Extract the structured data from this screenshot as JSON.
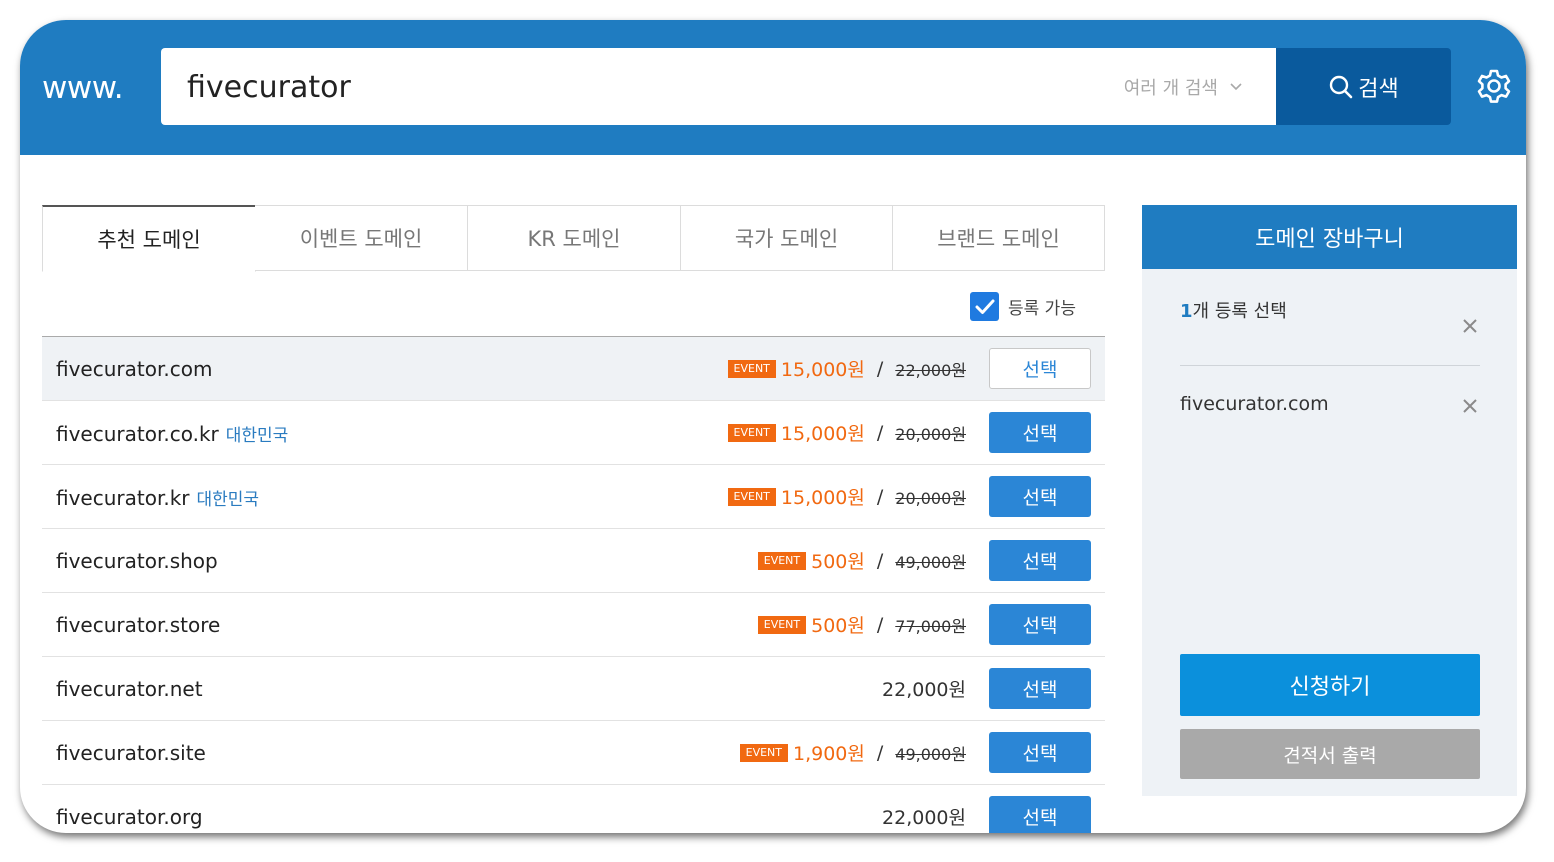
{
  "header": {
    "prefix": "www.",
    "search_value": "fivecurator",
    "multi_search_label": "여러 개 검색",
    "search_button_label": "검색",
    "colors": {
      "bar": "#1f7cc1",
      "search_button": "#0a5a9d"
    }
  },
  "tabs": [
    {
      "label": "추천 도메인",
      "active": true
    },
    {
      "label": "이벤트 도메인",
      "active": false
    },
    {
      "label": "KR 도메인",
      "active": false
    },
    {
      "label": "국가 도메인",
      "active": false
    },
    {
      "label": "브랜드 도메인",
      "active": false
    }
  ],
  "filter": {
    "available_label": "등록 가능",
    "checked": true
  },
  "domains": [
    {
      "name": "fivecurator.com",
      "country": "",
      "event": "EVENT",
      "price": "15,000원",
      "slash": "/",
      "original": "22,000원",
      "button": "선택",
      "selected": true
    },
    {
      "name": "fivecurator.co.kr",
      "country": "대한민국",
      "event": "EVENT",
      "price": "15,000원",
      "slash": "/",
      "original": "20,000원",
      "button": "선택",
      "selected": false
    },
    {
      "name": "fivecurator.kr",
      "country": "대한민국",
      "event": "EVENT",
      "price": "15,000원",
      "slash": "/",
      "original": "20,000원",
      "button": "선택",
      "selected": false
    },
    {
      "name": "fivecurator.shop",
      "country": "",
      "event": "EVENT",
      "price": "500원",
      "slash": "/",
      "original": "49,000원",
      "button": "선택",
      "selected": false
    },
    {
      "name": "fivecurator.store",
      "country": "",
      "event": "EVENT",
      "price": "500원",
      "slash": "/",
      "original": "77,000원",
      "button": "선택",
      "selected": false
    },
    {
      "name": "fivecurator.net",
      "country": "",
      "event": "",
      "price": "22,000원",
      "slash": "",
      "original": "",
      "button": "선택",
      "selected": false
    },
    {
      "name": "fivecurator.site",
      "country": "",
      "event": "EVENT",
      "price": "1,900원",
      "slash": "/",
      "original": "49,000원",
      "button": "선택",
      "selected": false
    },
    {
      "name": "fivecurator.org",
      "country": "",
      "event": "",
      "price": "22,000원",
      "slash": "",
      "original": "",
      "button": "선택",
      "selected": false
    }
  ],
  "cart": {
    "title": "도메인 장바구니",
    "count_num": "1",
    "count_text": "개 등록 선택",
    "items": [
      "fivecurator.com"
    ],
    "apply_label": "신청하기",
    "quote_label": "견적서 출력",
    "colors": {
      "apply": "#0b90dc",
      "quote": "#a9a9a9"
    }
  },
  "accent": {
    "event_orange": "#f16911",
    "select_blue": "#2b86d6",
    "country_blue": "#2a7bc0"
  }
}
